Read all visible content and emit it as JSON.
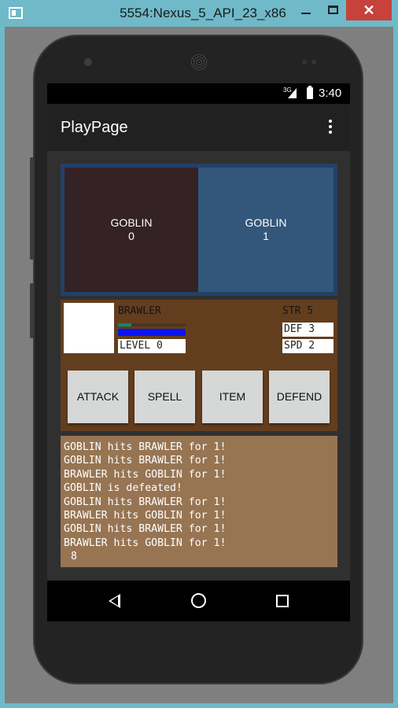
{
  "window": {
    "title": "5554:Nexus_5_API_23_x86",
    "minimize_icon": "minimize-icon",
    "maximize_icon": "maximize-icon",
    "close_label": "✕"
  },
  "statusbar": {
    "network": "3G",
    "time": "3:40"
  },
  "appbar": {
    "title": "PlayPage"
  },
  "monsters": [
    {
      "name": "GOBLIN",
      "index": "0",
      "color": "#342224"
    },
    {
      "name": "GOBLIN",
      "index": "1",
      "color": "#33577b"
    }
  ],
  "hero": {
    "name": "BRAWLER",
    "hp_fraction": 0.2,
    "xp_fraction": 1.0,
    "level": "LEVEL 0",
    "str": "STR 5",
    "def": "DEF 3",
    "spd": "SPD 2"
  },
  "actions": [
    "ATTACK",
    "SPELL",
    "ITEM",
    "DEFEND"
  ],
  "log": {
    "lines": [
      "GOBLIN hits BRAWLER for 1!",
      "GOBLIN hits BRAWLER for 1!",
      "BRAWLER hits GOBLIN for 1!",
      "GOBLIN is defeated!",
      "GOBLIN hits BRAWLER for 1!",
      "BRAWLER hits GOBLIN for 1!",
      "GOBLIN hits BRAWLER for 1!",
      "BRAWLER hits GOBLIN for 1!"
    ],
    "count": "8"
  },
  "colors": {
    "accent_titlebar": "#6fb9c9",
    "hero_panel": "#633e1e",
    "log_panel": "#977553",
    "hp_bar": "#13876c",
    "xp_bar": "#0b13f2"
  }
}
